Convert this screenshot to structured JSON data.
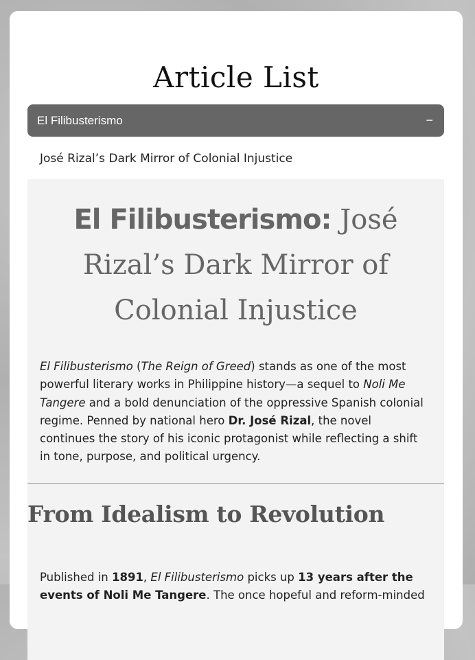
{
  "page": {
    "title": "Article List"
  },
  "accordion": {
    "header_label": "El Filibusterismo",
    "toggle_symbol": "−",
    "subtitle": "José Rizal’s Dark Mirror of Colonial Injustice"
  },
  "article": {
    "heading_bold": "El Filibusterismo:",
    "heading_rest": " José Rizal’s Dark Mirror of Colonial Injustice",
    "intro": {
      "t1": "El Filibusterismo",
      "t2": " (",
      "t3": "The Reign of Greed",
      "t4": ") stands as one of the most powerful literary works in Philippine history—a sequel to ",
      "t5": "Noli Me Tangere",
      "t6": " and a bold denunciation of the oppressive Spanish colonial regime. Penned by national hero ",
      "t7": "Dr. José Rizal",
      "t8": ", the novel continues the story of his iconic protagonist while reflecting a shift in tone, purpose, and political urgency."
    },
    "section_heading": "From Idealism to Revolution",
    "para2": {
      "t1": "Published in ",
      "t2": "1891",
      "t3": ", ",
      "t4": "El Filibusterismo",
      "t5": " picks up ",
      "t6": "13 years after the events of Noli Me Tangere",
      "t7": ". The once hopeful and reform-minded"
    }
  },
  "colors": {
    "header_bg": "#666666",
    "article_bg": "#f3f3f3",
    "heading_text": "#666666"
  }
}
